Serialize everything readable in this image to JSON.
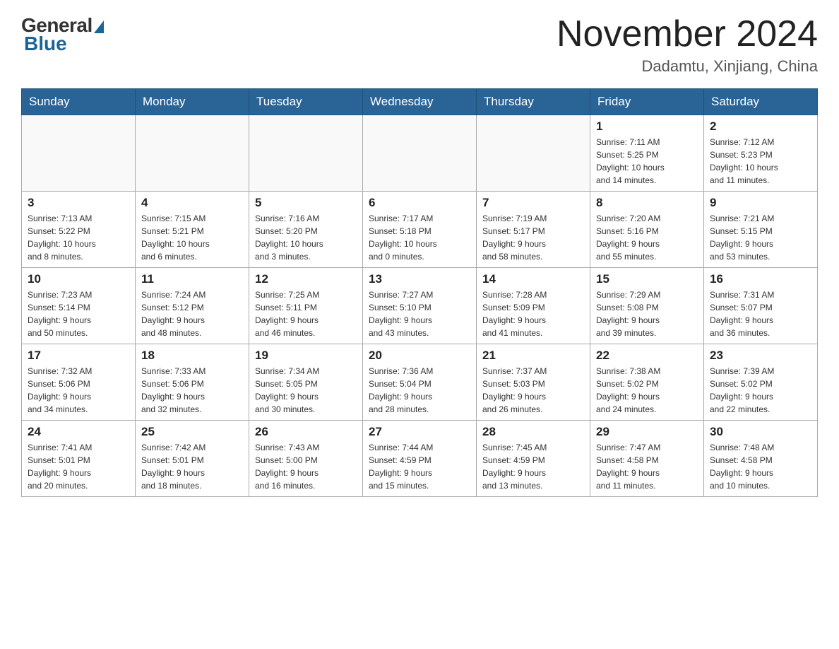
{
  "header": {
    "logo_general": "General",
    "logo_blue": "Blue",
    "month_title": "November 2024",
    "location": "Dadamtu, Xinjiang, China"
  },
  "days_of_week": [
    "Sunday",
    "Monday",
    "Tuesday",
    "Wednesday",
    "Thursday",
    "Friday",
    "Saturday"
  ],
  "weeks": [
    {
      "days": [
        {
          "number": "",
          "info": ""
        },
        {
          "number": "",
          "info": ""
        },
        {
          "number": "",
          "info": ""
        },
        {
          "number": "",
          "info": ""
        },
        {
          "number": "",
          "info": ""
        },
        {
          "number": "1",
          "info": "Sunrise: 7:11 AM\nSunset: 5:25 PM\nDaylight: 10 hours\nand 14 minutes."
        },
        {
          "number": "2",
          "info": "Sunrise: 7:12 AM\nSunset: 5:23 PM\nDaylight: 10 hours\nand 11 minutes."
        }
      ]
    },
    {
      "days": [
        {
          "number": "3",
          "info": "Sunrise: 7:13 AM\nSunset: 5:22 PM\nDaylight: 10 hours\nand 8 minutes."
        },
        {
          "number": "4",
          "info": "Sunrise: 7:15 AM\nSunset: 5:21 PM\nDaylight: 10 hours\nand 6 minutes."
        },
        {
          "number": "5",
          "info": "Sunrise: 7:16 AM\nSunset: 5:20 PM\nDaylight: 10 hours\nand 3 minutes."
        },
        {
          "number": "6",
          "info": "Sunrise: 7:17 AM\nSunset: 5:18 PM\nDaylight: 10 hours\nand 0 minutes."
        },
        {
          "number": "7",
          "info": "Sunrise: 7:19 AM\nSunset: 5:17 PM\nDaylight: 9 hours\nand 58 minutes."
        },
        {
          "number": "8",
          "info": "Sunrise: 7:20 AM\nSunset: 5:16 PM\nDaylight: 9 hours\nand 55 minutes."
        },
        {
          "number": "9",
          "info": "Sunrise: 7:21 AM\nSunset: 5:15 PM\nDaylight: 9 hours\nand 53 minutes."
        }
      ]
    },
    {
      "days": [
        {
          "number": "10",
          "info": "Sunrise: 7:23 AM\nSunset: 5:14 PM\nDaylight: 9 hours\nand 50 minutes."
        },
        {
          "number": "11",
          "info": "Sunrise: 7:24 AM\nSunset: 5:12 PM\nDaylight: 9 hours\nand 48 minutes."
        },
        {
          "number": "12",
          "info": "Sunrise: 7:25 AM\nSunset: 5:11 PM\nDaylight: 9 hours\nand 46 minutes."
        },
        {
          "number": "13",
          "info": "Sunrise: 7:27 AM\nSunset: 5:10 PM\nDaylight: 9 hours\nand 43 minutes."
        },
        {
          "number": "14",
          "info": "Sunrise: 7:28 AM\nSunset: 5:09 PM\nDaylight: 9 hours\nand 41 minutes."
        },
        {
          "number": "15",
          "info": "Sunrise: 7:29 AM\nSunset: 5:08 PM\nDaylight: 9 hours\nand 39 minutes."
        },
        {
          "number": "16",
          "info": "Sunrise: 7:31 AM\nSunset: 5:07 PM\nDaylight: 9 hours\nand 36 minutes."
        }
      ]
    },
    {
      "days": [
        {
          "number": "17",
          "info": "Sunrise: 7:32 AM\nSunset: 5:06 PM\nDaylight: 9 hours\nand 34 minutes."
        },
        {
          "number": "18",
          "info": "Sunrise: 7:33 AM\nSunset: 5:06 PM\nDaylight: 9 hours\nand 32 minutes."
        },
        {
          "number": "19",
          "info": "Sunrise: 7:34 AM\nSunset: 5:05 PM\nDaylight: 9 hours\nand 30 minutes."
        },
        {
          "number": "20",
          "info": "Sunrise: 7:36 AM\nSunset: 5:04 PM\nDaylight: 9 hours\nand 28 minutes."
        },
        {
          "number": "21",
          "info": "Sunrise: 7:37 AM\nSunset: 5:03 PM\nDaylight: 9 hours\nand 26 minutes."
        },
        {
          "number": "22",
          "info": "Sunrise: 7:38 AM\nSunset: 5:02 PM\nDaylight: 9 hours\nand 24 minutes."
        },
        {
          "number": "23",
          "info": "Sunrise: 7:39 AM\nSunset: 5:02 PM\nDaylight: 9 hours\nand 22 minutes."
        }
      ]
    },
    {
      "days": [
        {
          "number": "24",
          "info": "Sunrise: 7:41 AM\nSunset: 5:01 PM\nDaylight: 9 hours\nand 20 minutes."
        },
        {
          "number": "25",
          "info": "Sunrise: 7:42 AM\nSunset: 5:01 PM\nDaylight: 9 hours\nand 18 minutes."
        },
        {
          "number": "26",
          "info": "Sunrise: 7:43 AM\nSunset: 5:00 PM\nDaylight: 9 hours\nand 16 minutes."
        },
        {
          "number": "27",
          "info": "Sunrise: 7:44 AM\nSunset: 4:59 PM\nDaylight: 9 hours\nand 15 minutes."
        },
        {
          "number": "28",
          "info": "Sunrise: 7:45 AM\nSunset: 4:59 PM\nDaylight: 9 hours\nand 13 minutes."
        },
        {
          "number": "29",
          "info": "Sunrise: 7:47 AM\nSunset: 4:58 PM\nDaylight: 9 hours\nand 11 minutes."
        },
        {
          "number": "30",
          "info": "Sunrise: 7:48 AM\nSunset: 4:58 PM\nDaylight: 9 hours\nand 10 minutes."
        }
      ]
    }
  ]
}
